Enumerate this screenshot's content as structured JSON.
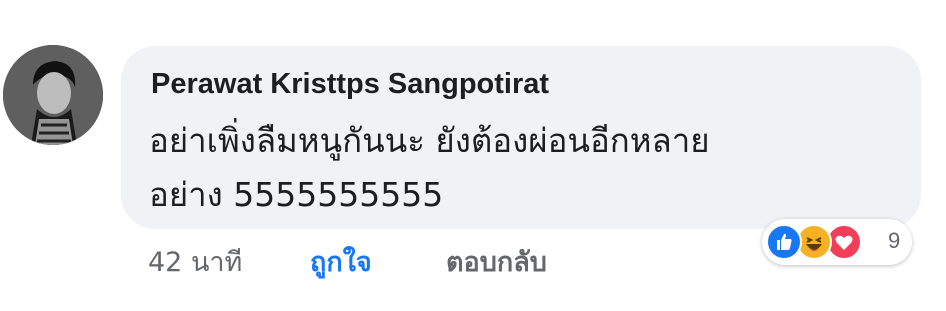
{
  "comment": {
    "author": "Perawat Kristtps Sangpotirat",
    "text_lines": [
      "อย่าเพิ่งลืมหนูกันนะ ยังต้องผ่อนอีกหลาย",
      "อย่าง 5555555555"
    ],
    "timestamp": "42 นาที",
    "like_action": "ถูกใจ",
    "reply_action": "ตอบกลับ"
  },
  "reactions": {
    "icons": [
      "like-icon",
      "haha-icon",
      "love-icon"
    ],
    "count": "9",
    "colors": {
      "like": "#1877f2",
      "haha": "#f7b125",
      "love": "#f33e58"
    }
  },
  "colors": {
    "bubble": "#f0f2f5",
    "author": "#1c1e21",
    "secondary": "#65676b",
    "accent": "#1877f2"
  }
}
